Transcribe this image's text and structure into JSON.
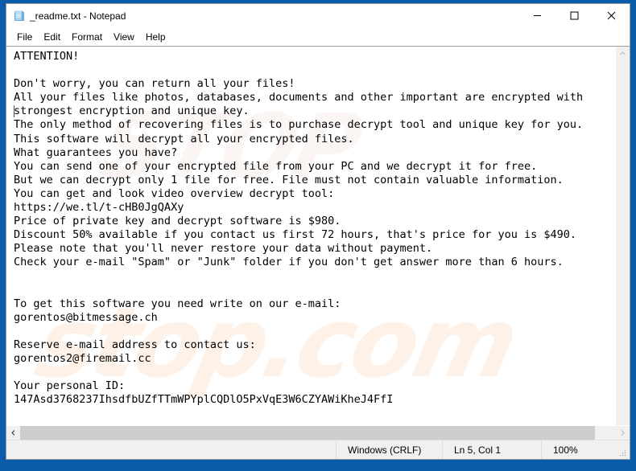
{
  "window": {
    "title": "_readme.txt - Notepad",
    "icon": "notepad-document-icon",
    "controls": {
      "minimize": "minimize-icon",
      "maximize": "maximize-icon",
      "close": "close-icon"
    }
  },
  "menu": {
    "items": [
      {
        "label": "File"
      },
      {
        "label": "Edit"
      },
      {
        "label": "Format"
      },
      {
        "label": "View"
      },
      {
        "label": "Help"
      }
    ]
  },
  "editor": {
    "watermark": "stop.com",
    "watermark_top": "STOP",
    "caret_line_index": 4,
    "lines": [
      "ATTENTION!",
      "",
      "Don't worry, you can return all your files!",
      "All your files like photos, databases, documents and other important are encrypted with",
      "strongest encryption and unique key.",
      "The only method of recovering files is to purchase decrypt tool and unique key for you.",
      "This software will decrypt all your encrypted files.",
      "What guarantees you have?",
      "You can send one of your encrypted file from your PC and we decrypt it for free.",
      "But we can decrypt only 1 file for free. File must not contain valuable information.",
      "You can get and look video overview decrypt tool:",
      "https://we.tl/t-cHB0JgQAXy",
      "Price of private key and decrypt software is $980.",
      "Discount 50% available if you contact us first 72 hours, that's price for you is $490.",
      "Please note that you'll never restore your data without payment.",
      "Check your e-mail \"Spam\" or \"Junk\" folder if you don't get answer more than 6 hours.",
      "",
      "",
      "To get this software you need write on our e-mail:",
      "gorentos@bitmessage.ch",
      "",
      "Reserve e-mail address to contact us:",
      "gorentos2@firemail.cc",
      "",
      "Your personal ID:",
      "147Asd3768237IhsdfbUZfTTmWPYplCQDlO5PxVqE3W6CZYAWiKheJ4FfI"
    ]
  },
  "scrollbars": {
    "vertical_up": "scroll-up-arrow-icon",
    "vertical_down": "scroll-down-arrow-icon",
    "horizontal_left": "scroll-left-arrow-icon",
    "horizontal_right": "scroll-right-arrow-icon"
  },
  "status_bar": {
    "eol": "Windows (CRLF)",
    "position": "Ln 5, Col 1",
    "zoom": "100%"
  },
  "colors": {
    "desktop": "#0b5cab",
    "window_bg": "#ffffff",
    "status_bg": "#f0f0f0",
    "scrollbar_thumb": "#cdcdcd",
    "text": "#000000",
    "watermark": "#fdf1e8"
  }
}
